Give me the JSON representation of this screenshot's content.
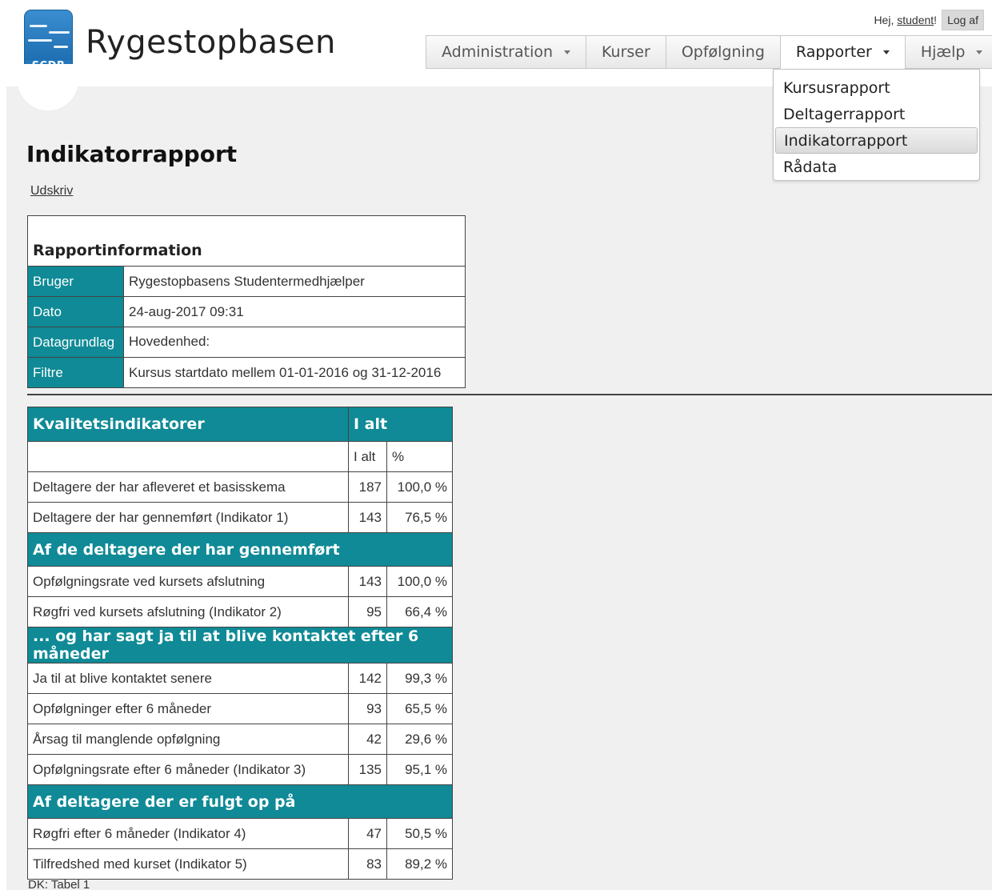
{
  "brand": {
    "logo_text": "SCDB",
    "name": "Rygestopbasen"
  },
  "userbar": {
    "greeting": "Hej,",
    "username": "student",
    "suffix": "!",
    "logout": "Log af"
  },
  "nav": [
    {
      "label": "Administration",
      "has_caret": true
    },
    {
      "label": "Kurser",
      "has_caret": false
    },
    {
      "label": "Opfølgning",
      "has_caret": false
    },
    {
      "label": "Rapporter",
      "has_caret": true,
      "active": true
    },
    {
      "label": "Hjælp",
      "has_caret": true
    }
  ],
  "dropdown": [
    "Kursusrapport",
    "Deltagerrapport",
    "Indikatorrapport",
    "Rådata"
  ],
  "page": {
    "title": "Indikatorrapport",
    "print": "Udskriv"
  },
  "info": {
    "heading": "Rapportinformation",
    "rows": [
      {
        "label": "Bruger",
        "value": "Rygestopbasens Studentermedhjælper"
      },
      {
        "label": "Dato",
        "value": "24-aug-2017 09:31"
      },
      {
        "label": "Datagrundlag",
        "value": "Hovedenhed:"
      },
      {
        "label": "Filtre",
        "value": "Kursus startdato mellem 01-01-2016 og 31-12-2016"
      }
    ]
  },
  "kpi": {
    "header": {
      "title": "Kvalitetsindikatorer",
      "total": "I alt"
    },
    "subheader": {
      "count": "I alt",
      "pct": "%"
    },
    "rows": [
      {
        "label": "Deltagere der har afleveret et basisskema",
        "count": "187",
        "pct": "100,0 %"
      },
      {
        "label": "Deltagere der har gennemført (Indikator 1)",
        "count": "143",
        "pct": "76,5 %"
      }
    ],
    "section1": "Af de deltagere der har gennemført",
    "rows1": [
      {
        "label": "Opfølgningsrate ved kursets afslutning",
        "count": "143",
        "pct": "100,0 %"
      },
      {
        "label": "Røgfri ved kursets afslutning (Indikator 2)",
        "count": "95",
        "pct": "66,4 %"
      }
    ],
    "section2": "... og har sagt ja til at blive kontaktet efter 6 måneder",
    "rows2": [
      {
        "label": "Ja til at blive kontaktet senere",
        "count": "142",
        "pct": "99,3 %"
      },
      {
        "label": "Opfølgninger efter 6 måneder",
        "count": "93",
        "pct": "65,5 %"
      },
      {
        "label": "Årsag til manglende opfølgning",
        "count": "42",
        "pct": "29,6 %"
      },
      {
        "label": "Opfølgningsrate efter 6 måneder (Indikator 3)",
        "count": "135",
        "pct": "95,1 %"
      }
    ],
    "section3": "Af deltagere der er fulgt op på",
    "rows3": [
      {
        "label": "Røgfri efter 6 måneder (Indikator 4)",
        "count": "47",
        "pct": "50,5 %"
      },
      {
        "label": "Tilfredshed med kurset (Indikator 5)",
        "count": "83",
        "pct": "89,2 %"
      }
    ]
  },
  "caption": "DK: Tabel 1"
}
